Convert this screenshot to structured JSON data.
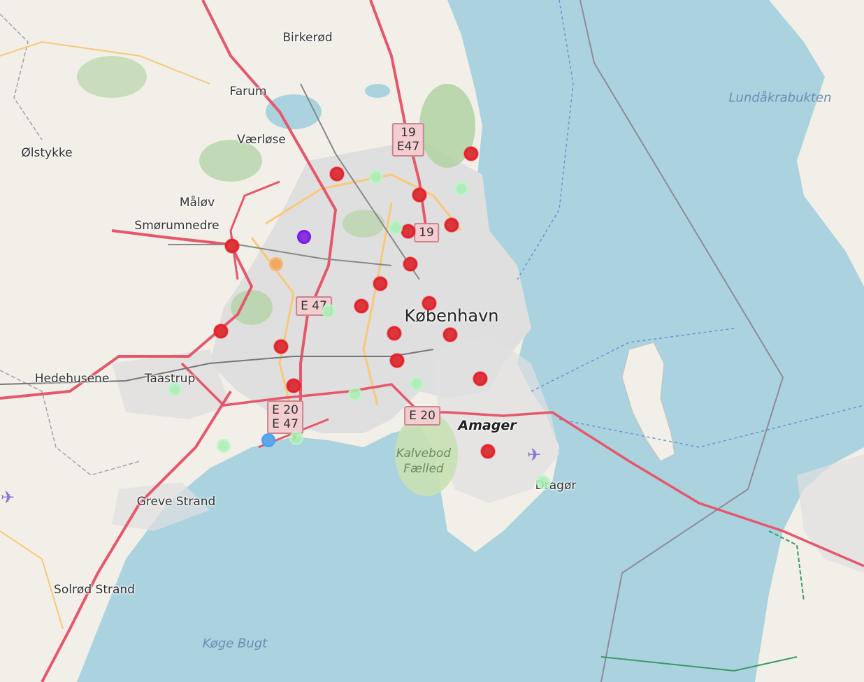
{
  "map": {
    "colors": {
      "water": "#aad3df",
      "land": "#f2efe9",
      "urban": "#e0dfdf",
      "forest": "#add19e",
      "motorway": "#e5576b",
      "trunk": "#f9b29c",
      "primary": "#fcd6a4",
      "boundary": "#8e8b96"
    },
    "places": [
      {
        "name": "Birkerød",
        "class": "place"
      },
      {
        "name": "Farum",
        "class": "place"
      },
      {
        "name": "Værløse",
        "class": "place"
      },
      {
        "name": "Ølstykke",
        "class": "place"
      },
      {
        "name": "Måløv",
        "class": "place"
      },
      {
        "name": "Smørumnedre",
        "class": "place"
      },
      {
        "name": "København",
        "class": "big"
      },
      {
        "name": "Hedehusene",
        "class": "place"
      },
      {
        "name": "Taastrup",
        "class": "place"
      },
      {
        "name": "Amager",
        "class": "island"
      },
      {
        "name": "Dragør",
        "class": "place"
      },
      {
        "name": "Greve Strand",
        "class": "place"
      },
      {
        "name": "Solrød Strand",
        "class": "place"
      },
      {
        "name": "Køge Bugt",
        "class": "water"
      },
      {
        "name": "Lundåkrabukten",
        "class": "water"
      }
    ],
    "park_label": {
      "line1": "Kalvebod",
      "line2": "Fælled"
    },
    "shields": [
      {
        "line1": "19",
        "line2": "E47"
      },
      {
        "line1": "19",
        "line2": ""
      },
      {
        "line1": "E 47",
        "line2": ""
      },
      {
        "line1": "E 20",
        "line2": "E 47"
      },
      {
        "line1": "E 20",
        "line2": ""
      }
    ],
    "airports": [
      {
        "icon": "airplane-icon"
      },
      {
        "icon": "airplane-icon"
      }
    ],
    "markers": {
      "red": 22,
      "green": 13,
      "purple": 1,
      "orange": 1,
      "blue": 1
    }
  }
}
